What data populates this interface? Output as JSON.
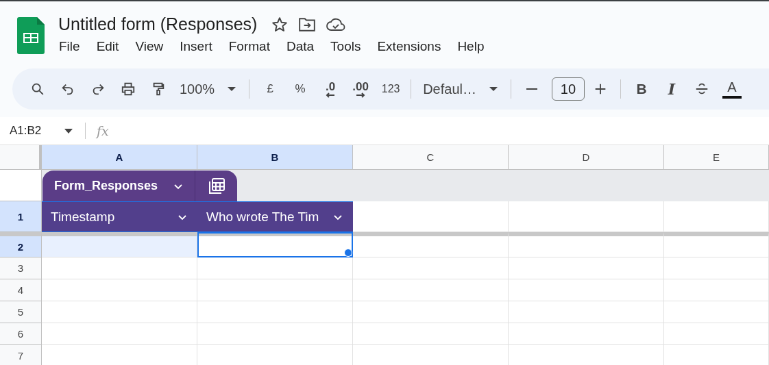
{
  "document": {
    "title": "Untitled form (Responses)"
  },
  "menu": [
    "File",
    "Edit",
    "View",
    "Insert",
    "Format",
    "Data",
    "Tools",
    "Extensions",
    "Help"
  ],
  "toolbar": {
    "zoom": "100%",
    "currency": "£",
    "percent": "%",
    "decrease_decimals": ".0",
    "increase_decimals": ".00",
    "number_format": "123",
    "font": "Defaul…",
    "font_size": "10",
    "bold": "B",
    "italic": "I",
    "text_color": "A"
  },
  "formula_bar": {
    "name_box": "A1:B2",
    "fx": "fx"
  },
  "grid": {
    "columns": [
      {
        "label": "A",
        "selected": true
      },
      {
        "label": "B",
        "selected": true
      },
      {
        "label": "C",
        "selected": false
      },
      {
        "label": "D",
        "selected": false
      },
      {
        "label": "E",
        "selected": false
      }
    ],
    "table": {
      "name": "Form_Responses",
      "headers": [
        "Timestamp",
        "Who wrote The Tim"
      ]
    },
    "rows": [
      {
        "label": "1",
        "selected": true
      },
      {
        "label": "2",
        "selected": true,
        "cells": [
          {
            "selected": true,
            "active": false
          },
          {
            "active": true
          }
        ]
      },
      {
        "label": "3",
        "selected": false
      },
      {
        "label": "4",
        "selected": false
      },
      {
        "label": "5",
        "selected": false
      },
      {
        "label": "6",
        "selected": false
      },
      {
        "label": "7",
        "selected": false
      }
    ]
  }
}
